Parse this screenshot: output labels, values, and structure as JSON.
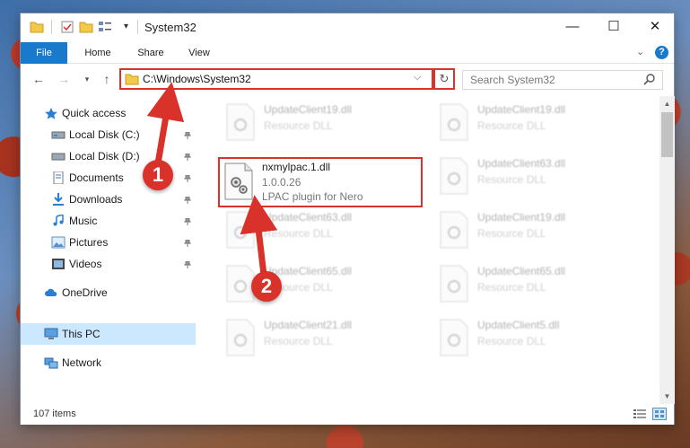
{
  "window": {
    "title": "System32",
    "controls": {
      "minimize": "—",
      "maximize": "☐",
      "close": "✕"
    }
  },
  "ribbon": {
    "tabs": [
      "File",
      "Home",
      "Share",
      "View"
    ],
    "help": "?"
  },
  "navigation": {
    "address": "C:\\Windows\\System32",
    "search_placeholder": "Search System32"
  },
  "nav_pane": {
    "quick_access": "Quick access",
    "items": [
      {
        "label": "Local Disk (C:)",
        "icon": "drive-icon",
        "pinned": true
      },
      {
        "label": "Local Disk (D:)",
        "icon": "drive-icon",
        "pinned": true
      },
      {
        "label": "Documents",
        "icon": "documents-icon",
        "pinned": true
      },
      {
        "label": "Downloads",
        "icon": "downloads-icon",
        "pinned": true
      },
      {
        "label": "Music",
        "icon": "music-icon",
        "pinned": true
      },
      {
        "label": "Pictures",
        "icon": "pictures-icon",
        "pinned": true
      },
      {
        "label": "Videos",
        "icon": "videos-icon",
        "pinned": true
      }
    ],
    "onedrive": "OneDrive",
    "this_pc": "This PC",
    "network": "Network"
  },
  "files": {
    "highlighted": {
      "name": "nxmylpac.1.dll",
      "version": "1.0.0.26",
      "description": "LPAC plugin for Nero"
    },
    "background_files": [
      {
        "name": "UpdateClient19.dll",
        "type": "Resource DLL"
      },
      {
        "name": "UpdateClient19.dll",
        "type": "Resource DLL"
      },
      {
        "name": "UpdateClient63.dll",
        "type": "Resource DLL"
      },
      {
        "name": "UpdateClient63.dll",
        "type": "Resource DLL"
      },
      {
        "name": "UpdateClient19.dll",
        "type": "Resource DLL"
      },
      {
        "name": "UpdateClient65.dll",
        "type": "Resource DLL"
      },
      {
        "name": "UpdateClient65.dll",
        "type": "Resource DLL"
      },
      {
        "name": "UpdateClient21.dll",
        "type": "Resource DLL"
      },
      {
        "name": "UpdateClient5.dll",
        "type": "Resource DLL"
      }
    ]
  },
  "status": {
    "item_count": "107 items"
  },
  "callouts": [
    "1",
    "2"
  ],
  "colors": {
    "accent": "#1979ca",
    "highlight": "#d9322a",
    "selected": "#cce8ff"
  }
}
